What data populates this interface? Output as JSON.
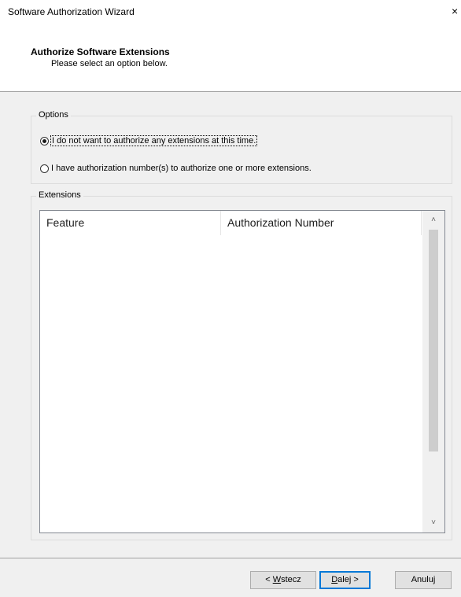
{
  "window": {
    "title": "Software Authorization Wizard",
    "close_glyph": "×"
  },
  "header": {
    "title": "Authorize Software Extensions",
    "subtitle": "Please select an option below."
  },
  "options": {
    "group_label": "Options",
    "radio_no_auth": {
      "label": "I do not want to authorize any extensions at this time.",
      "selected": true
    },
    "radio_have_auth": {
      "label": "I have authorization number(s) to authorize one or more extensions.",
      "selected": false
    }
  },
  "extensions": {
    "group_label": "Extensions",
    "columns": [
      "Feature",
      "Authorization Number"
    ],
    "rows": []
  },
  "icons": {
    "scroll_up": "chevron-up-icon",
    "scroll_down": "chevron-down-icon",
    "close": "close-icon"
  },
  "buttons": {
    "back": {
      "prefix": "< ",
      "mnemonic": "W",
      "rest": "stecz"
    },
    "next": {
      "mnemonic": "D",
      "rest": "alej >"
    },
    "cancel": {
      "label": "Anuluj"
    }
  },
  "colors": {
    "default_button_border": "#0078d7",
    "background": "#f0f0f0"
  }
}
